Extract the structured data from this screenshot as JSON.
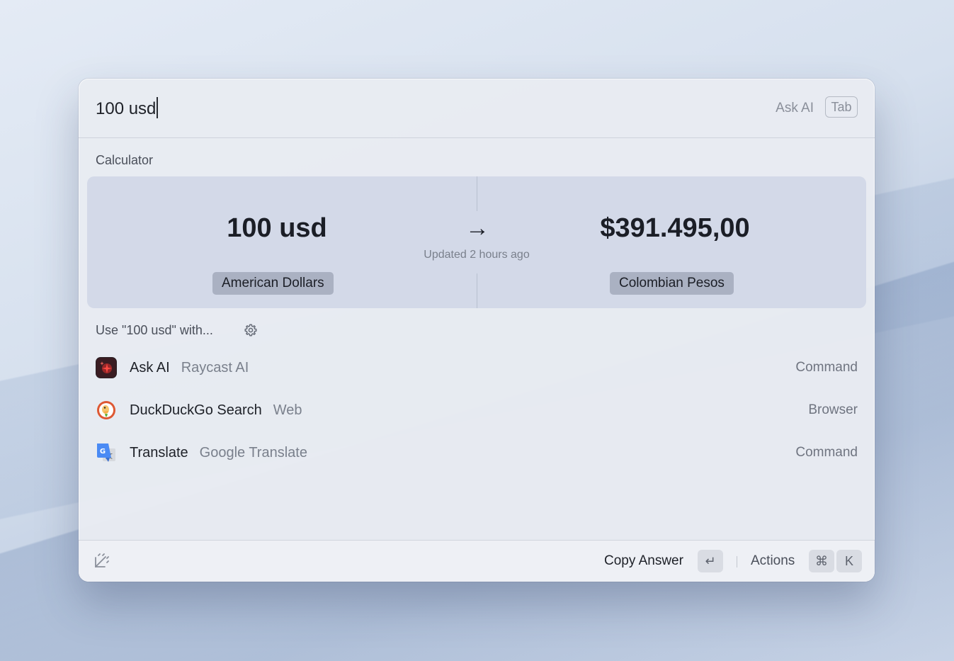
{
  "search": {
    "query": "100 usd",
    "ask_ai_hint": "Ask AI",
    "tab_key": "Tab"
  },
  "calculator": {
    "section_title": "Calculator",
    "input_value": "100 usd",
    "input_unit": "American Dollars",
    "output_value": "$391.495,00",
    "output_unit": "Colombian Pesos",
    "arrow": "→",
    "updated": "Updated 2 hours ago"
  },
  "fallback": {
    "title": "Use \"100 usd\" with...",
    "settings_icon": "gear-icon",
    "items": [
      {
        "title": "Ask AI",
        "subtitle": "Raycast AI",
        "kind": "Command",
        "icon": "raycast-ai-icon"
      },
      {
        "title": "DuckDuckGo Search",
        "subtitle": "Web",
        "kind": "Browser",
        "icon": "duckduckgo-icon"
      },
      {
        "title": "Translate",
        "subtitle": "Google Translate",
        "kind": "Command",
        "icon": "google-translate-icon"
      }
    ]
  },
  "footer": {
    "logo_icon": "raycast-logo-icon",
    "primary_action": "Copy Answer",
    "primary_key": "↵",
    "actions_label": "Actions",
    "actions_keys": [
      "⌘",
      "K"
    ]
  }
}
